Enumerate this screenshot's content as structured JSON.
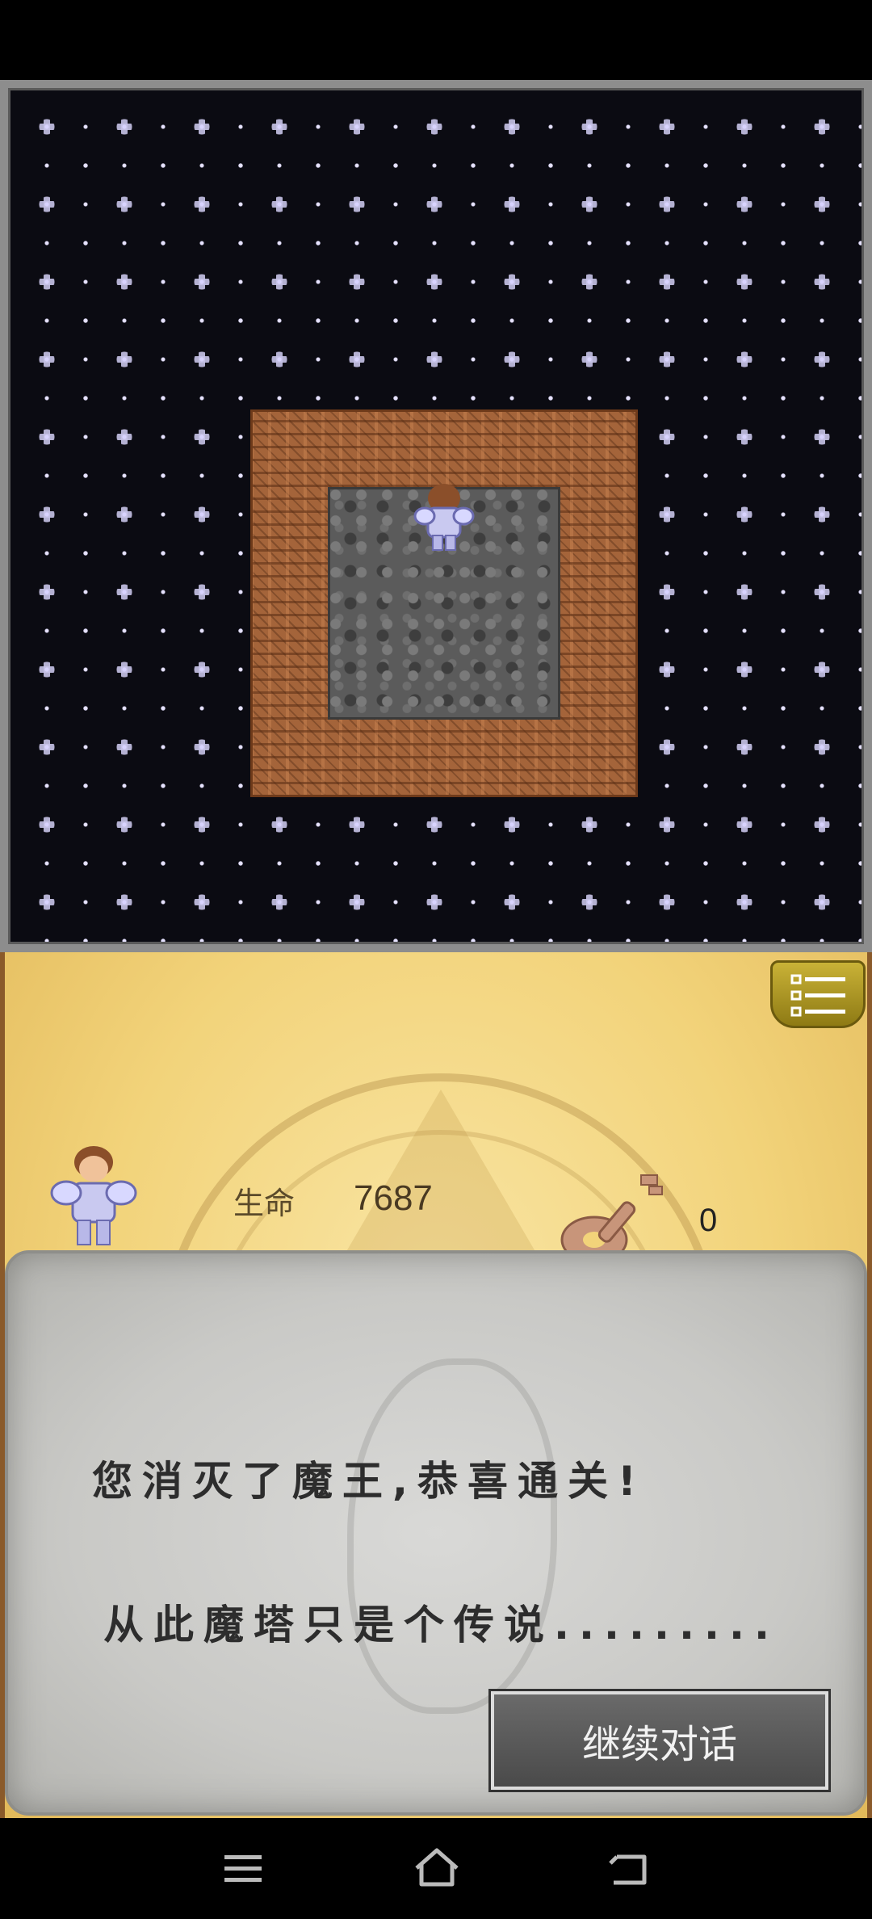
{
  "status": {
    "hp_label": "生命",
    "hp_value": "7687",
    "key_count": "0"
  },
  "dialog": {
    "line1": "您消灭了魔王,恭喜通关!",
    "line2": "从此魔塔只是个传说.........",
    "continue_label": "继续对话"
  },
  "icons": {
    "menu": "menu-list-icon",
    "key": "key-icon",
    "hero": "hero-knight-icon",
    "nav_menu": "menu-icon",
    "nav_home": "home-icon",
    "nav_back": "back-icon"
  },
  "colors": {
    "panel": "#f2d37a",
    "dialog": "#c9c9c6",
    "button": "#4a4a4a",
    "brick": "#a4643a",
    "stone": "#5b5b5b"
  }
}
